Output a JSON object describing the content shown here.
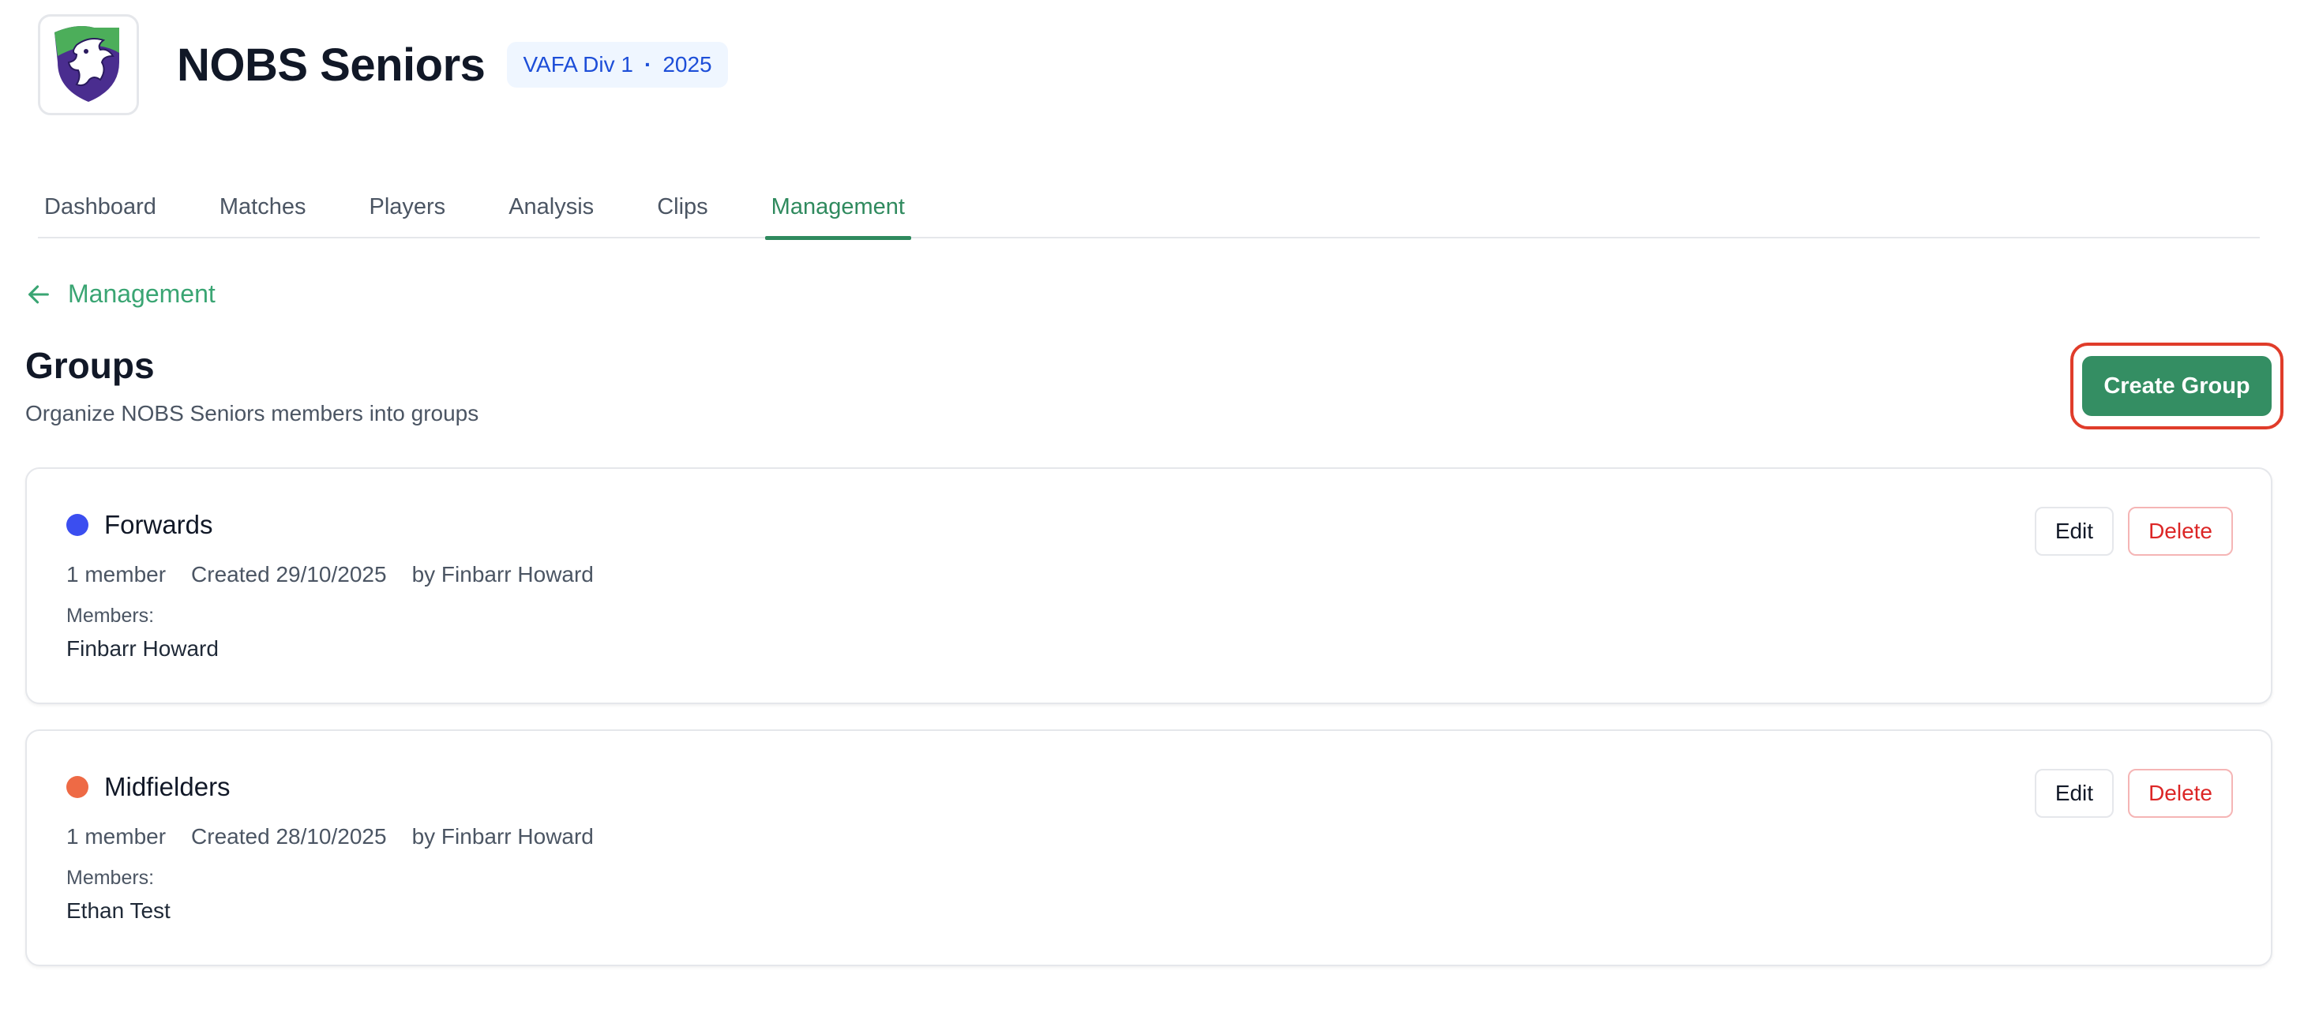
{
  "header": {
    "team_name": "NOBS Seniors",
    "league": "VAFA Div 1",
    "separator": "·",
    "season": "2025",
    "logo_icon": "griffin-shield-icon"
  },
  "tabs": [
    {
      "label": "Dashboard",
      "active": false
    },
    {
      "label": "Matches",
      "active": false
    },
    {
      "label": "Players",
      "active": false
    },
    {
      "label": "Analysis",
      "active": false
    },
    {
      "label": "Clips",
      "active": false
    },
    {
      "label": "Management",
      "active": true
    }
  ],
  "back_link": {
    "label": "Management",
    "icon": "arrow-left-icon"
  },
  "page": {
    "title": "Groups",
    "subtitle": "Organize NOBS Seniors members into groups",
    "create_label": "Create Group"
  },
  "groups": [
    {
      "name": "Forwards",
      "color": "#3b4ef0",
      "member_count": "1 member",
      "created": "Created 29/10/2025",
      "by": "by Finbarr Howard",
      "members_label": "Members:",
      "members": "Finbarr Howard",
      "edit_label": "Edit",
      "delete_label": "Delete"
    },
    {
      "name": "Midfielders",
      "color": "#ee6a45",
      "member_count": "1 member",
      "created": "Created 28/10/2025",
      "by": "by Finbarr Howard",
      "members_label": "Members:",
      "members": "Ethan Test",
      "edit_label": "Edit",
      "delete_label": "Delete"
    }
  ],
  "colors": {
    "accent": "#348e63",
    "highlight": "#e03c2a"
  }
}
